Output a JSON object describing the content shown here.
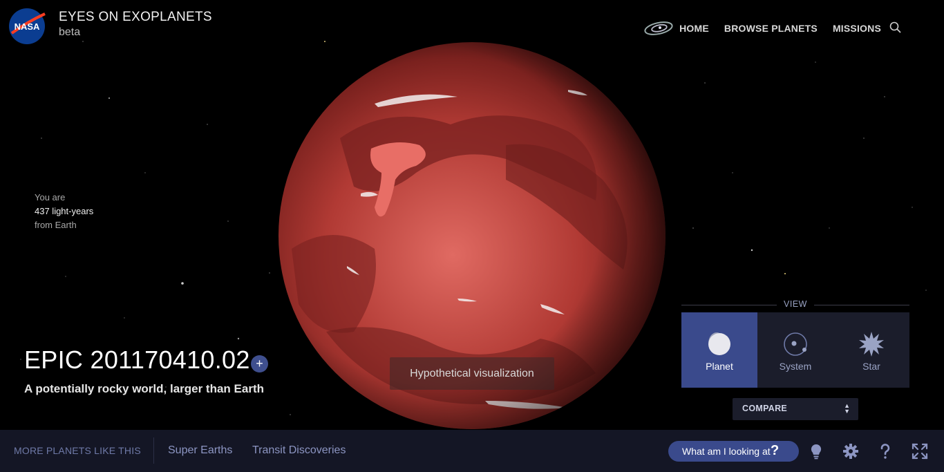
{
  "header": {
    "logo_text": "NASA",
    "title": "EYES ON EXOPLANETS",
    "subtitle": "beta",
    "nav": {
      "home": "HOME",
      "browse": "BROWSE PLANETS",
      "missions": "MISSIONS"
    }
  },
  "distance": {
    "line1": "You are",
    "value": "437 light-years",
    "line3": "from Earth"
  },
  "planet": {
    "name": "EPIC 201170410.02",
    "plus": "+",
    "description": "A potentially rocky world, larger than Earth",
    "visualization_label": "Hypothetical visualization"
  },
  "view": {
    "heading": "VIEW",
    "options": [
      {
        "label": "Planet",
        "icon": "planet-icon",
        "active": true
      },
      {
        "label": "System",
        "icon": "system-icon",
        "active": false
      },
      {
        "label": "Star",
        "icon": "star-icon",
        "active": false
      }
    ],
    "compare_label": "COMPARE"
  },
  "bottombar": {
    "more_label": "MORE PLANETS LIKE THIS",
    "categories": [
      "Super Earths",
      "Transit Discoveries"
    ],
    "looking_label": "What am I looking at",
    "looking_q": "?"
  },
  "colors": {
    "accent": "#3a4a8c",
    "bar_bg": "#141625",
    "planet_red": "#c0463e"
  }
}
